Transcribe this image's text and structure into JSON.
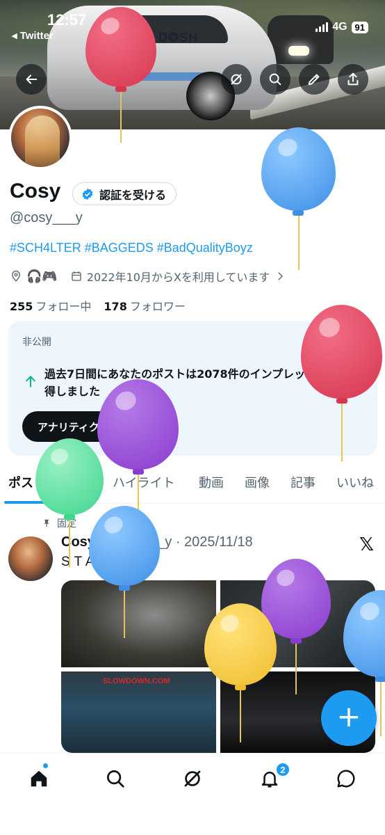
{
  "status_bar": {
    "time": "12:57",
    "back_app": "◂ Twitter",
    "network": "4G",
    "battery": "91"
  },
  "banner": {
    "car_logo": "D✪SH"
  },
  "profile": {
    "name": "Cosy",
    "verify_label": "認証を受ける",
    "handle": "@cosy___y",
    "bio": "#SCH4LTER #BAGGEDS #BadQualityBoyz",
    "emoji": "🎧🎮",
    "joined": "2022年10月からXを利用しています",
    "following_count": "255",
    "following_label": "フォロー中",
    "followers_count": "178",
    "followers_label": "フォロワー"
  },
  "private_card": {
    "label": "非公開",
    "close": "×",
    "message": "過去7日間にあなたのポストは2078件のインプレッションを獲得しました",
    "button": "アナリティクスを利用する"
  },
  "tabs": [
    "ポスト",
    "返信",
    "ハイライト",
    "動画",
    "画像",
    "記事",
    "いいね"
  ],
  "post": {
    "pinned_label": "固定",
    "author": "Cosy",
    "handle_date": "@cosy___y · 2025/11/18",
    "text": "STAYEND",
    "x_mark": "𝕏",
    "photo_tag": "SLOWDOWN.COM"
  },
  "fab": {
    "label": "+"
  },
  "nav": {
    "notifications_badge": "2"
  },
  "colors": {
    "accent": "#1d9bf0",
    "text": "#0f1419",
    "secondary": "#536471",
    "card_bg": "#edf5fd"
  },
  "icons": [
    "back-arrow-icon",
    "grok-icon",
    "search-icon",
    "edit-icon",
    "share-icon",
    "verified-icon",
    "location-icon",
    "calendar-icon",
    "chevron-right-icon",
    "arrow-up-icon",
    "pin-icon",
    "home-icon",
    "search-icon",
    "grok-icon",
    "bell-icon",
    "chat-icon"
  ]
}
